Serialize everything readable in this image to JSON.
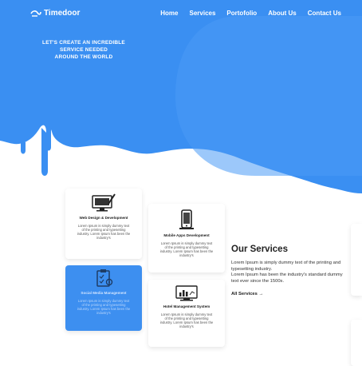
{
  "nav": {
    "logo_text": "Timedoor",
    "links": [
      "Home",
      "Services",
      "Portofolio",
      "About Us",
      "Contact Us"
    ]
  },
  "hero": {
    "line1": "LET'S CREATE AN INCREDIBLE",
    "line2": "SERVICE NEEDED",
    "line3": "AROUND THE WORLD"
  },
  "cards": [
    {
      "title": "Web Design & Development",
      "desc": "Lorem Ipsum is simply dummy text of the printing and typesetting industry. Lorem Ipsum has been the industry's",
      "icon": "monitor-pen-icon"
    },
    {
      "title": "Mobile Apps Development",
      "desc": "Lorem Ipsum is simply dummy text of the printing and typesetting industry. Lorem Ipsum has been the industry's",
      "icon": "mobile-phone-icon"
    },
    {
      "title": "Social Media Management",
      "desc": "Lorem Ipsum is simply dummy text of the printing and typesetting industry. Lorem Ipsum has been the industry's",
      "icon": "clipboard-settings-icon"
    },
    {
      "title": "Hotel Management System",
      "desc": "Lorem Ipsum is simply dummy text of the printing and typesetting industry. Lorem Ipsum has been the industry's",
      "icon": "dashboard-chart-icon"
    }
  ],
  "services": {
    "heading": "Our Services",
    "para1": "Lorem Ipsum is simply dummy text of the printing and typesetting industry.",
    "para2": "Lorem Ipsum has been the industry's standard dummy text ever since the 1500s.",
    "link": "All Services →"
  },
  "colors": {
    "primary": "#3a8ff2",
    "primary_light": "#4a9bf5",
    "white": "#ffffff"
  }
}
